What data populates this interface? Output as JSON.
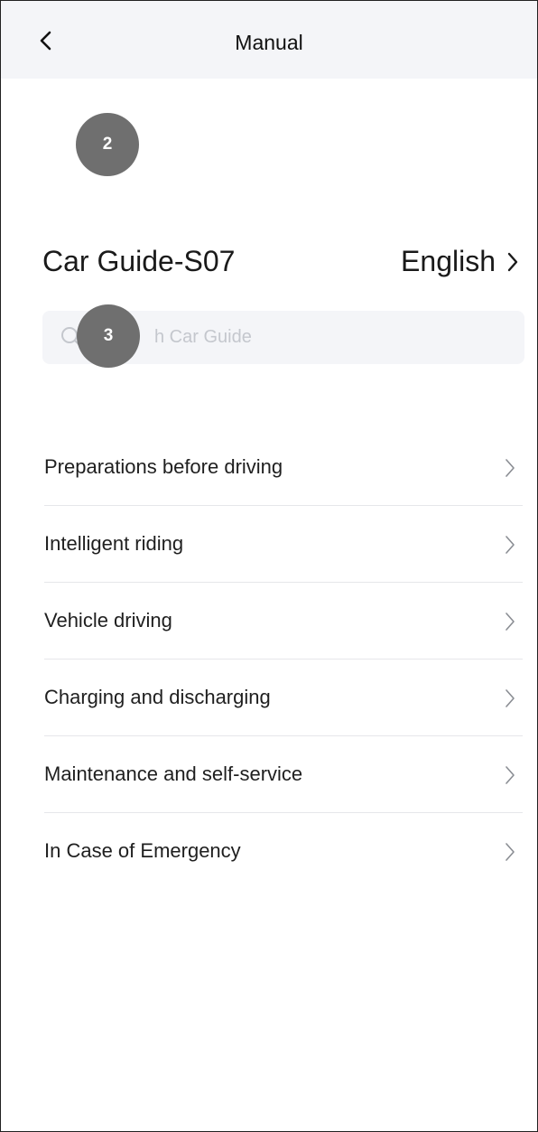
{
  "nav": {
    "title": "Manual",
    "back_icon": "chevron-left-icon"
  },
  "badges": {
    "first": "2",
    "second": "3"
  },
  "guide": {
    "title": "Car Guide-S07",
    "language": "English"
  },
  "search": {
    "placeholder_visible": "h Car Guide",
    "icon": "search-icon"
  },
  "menu": {
    "items": [
      {
        "label": "Preparations before driving"
      },
      {
        "label": "Intelligent riding"
      },
      {
        "label": "Vehicle driving"
      },
      {
        "label": "Charging and discharging"
      },
      {
        "label": "Maintenance and self-service"
      },
      {
        "label": "In Case of Emergency"
      }
    ]
  },
  "colors": {
    "nav_bg": "#f4f5f8",
    "badge": "#6f6f6f",
    "divider": "#e6e7ea",
    "placeholder": "#c4c7cd"
  }
}
